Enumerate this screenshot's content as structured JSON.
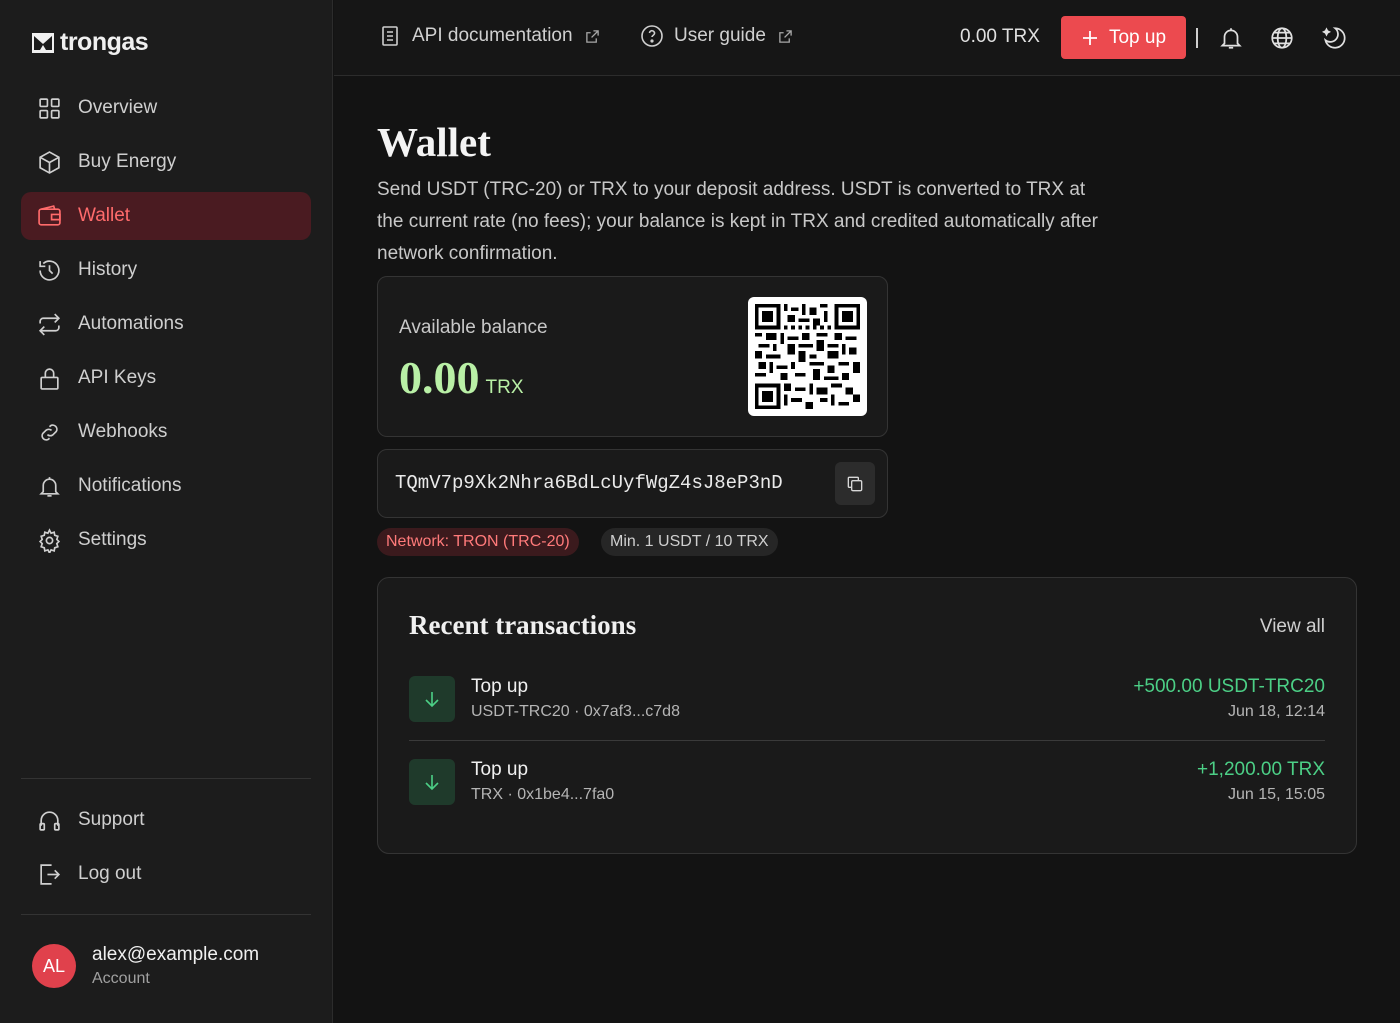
{
  "brand": {
    "name": "trongas"
  },
  "sidebar": {
    "items": [
      {
        "label": "Overview",
        "icon": "grid-icon"
      },
      {
        "label": "Buy Energy",
        "icon": "box-icon"
      },
      {
        "label": "Wallet",
        "icon": "wallet-icon",
        "active": true
      },
      {
        "label": "History",
        "icon": "history-icon"
      },
      {
        "label": "Automations",
        "icon": "repeat-icon"
      },
      {
        "label": "API Keys",
        "icon": "lock-icon"
      },
      {
        "label": "Webhooks",
        "icon": "link-icon"
      },
      {
        "label": "Notifications",
        "icon": "bell-icon"
      },
      {
        "label": "Settings",
        "icon": "gear-icon"
      }
    ],
    "bottom_items": [
      {
        "label": "Support",
        "icon": "headphones-icon"
      },
      {
        "label": "Log out",
        "icon": "logout-icon"
      }
    ],
    "user": {
      "initials": "AL",
      "email": "alex@example.com",
      "subtitle": "Account"
    }
  },
  "topbar": {
    "api_docs": "API documentation",
    "user_guide": "User guide",
    "balance": "0.00 TRX",
    "topup_label": "Top up"
  },
  "page": {
    "title": "Wallet",
    "description": "Send USDT (TRC-20) or TRX to your deposit address. USDT is converted to TRX at the current rate (no fees); your balance is kept in TRX and credited automatically after network confirmation."
  },
  "balance_card": {
    "label": "Available balance",
    "amount": "0.00",
    "unit": "TRX"
  },
  "deposit": {
    "address": "TQmV7p9Xk2Nhra6BdLcUyfWgZ4sJ8eP3nD",
    "network_tag": "Network: TRON (TRC-20)",
    "min_tag": "Min. 1 USDT / 10 TRX"
  },
  "transactions": {
    "title": "Recent transactions",
    "view_all": "View all",
    "rows": [
      {
        "name": "Top up",
        "meta": "USDT-TRC20 · 0x7af3...c7d8",
        "amount": "+500.00 USDT-TRC20",
        "date": "Jun 18, 12:14"
      },
      {
        "name": "Top up",
        "meta": "TRX · 0x1be4...7fa0",
        "amount": "+1,200.00 TRX",
        "date": "Jun 15, 15:05"
      }
    ]
  },
  "colors": {
    "accent": "#ec4a4f",
    "active_bg": "#4a1b21",
    "balance": "#b9f0a6",
    "positive": "#4ccf86"
  }
}
